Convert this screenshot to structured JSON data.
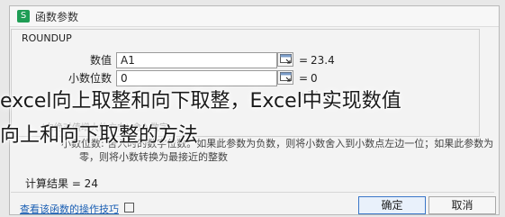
{
  "dialog": {
    "title": "函数参数"
  },
  "function": {
    "name": "ROUNDUP"
  },
  "args": [
    {
      "label": "数值",
      "value": "A1",
      "result": "23.4"
    },
    {
      "label": "小数位数",
      "value": "0",
      "result": "0"
    }
  ],
  "faded_text": {
    "line1": "= 24",
    "line2": "(向绝对值增大的方向) 舍入数字。",
    "line3": "小数位数: 舍入时的数字位数。如果此参数为负数，则将小数舍入到小数点左边一位；如果此参数为",
    "line4": "零，则将小数转换为最接近的整数"
  },
  "overlay": {
    "line1": "excel向上取整和向下取整，Excel中实现数值",
    "line2": "向上和向下取整的方法"
  },
  "result": {
    "text": "计算结果 =  24"
  },
  "footer": {
    "help_link": "查看该函数的操作技巧",
    "ok_label": "确定",
    "cancel_label": "取消"
  },
  "colors": {
    "link": "#1a5fb4",
    "app_icon": "#1f9d55"
  }
}
